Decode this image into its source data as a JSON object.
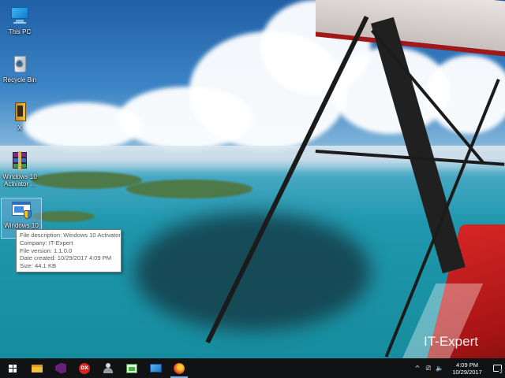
{
  "desktop": {
    "icons": [
      {
        "label": "This PC",
        "icon": "computer-icon"
      },
      {
        "label": "Recycle Bin",
        "icon": "recycle-bin-icon"
      },
      {
        "label": "X",
        "icon": "book-icon"
      },
      {
        "label": "Windows 10 Activator ...",
        "icon": "winrar-archive-icon"
      },
      {
        "label": "Windows 10 Ac",
        "icon": "activator-app-icon"
      }
    ],
    "watermark": "IT-Expert"
  },
  "tooltip": {
    "lines": [
      "File description: Windows 10 Activator",
      "Company: IT-Expert",
      "File version: 1.1.0.0",
      "Date created: 10/29/2017 4:09 PM",
      "Size: 44.1 KB"
    ]
  },
  "taskbar": {
    "pinned": [
      {
        "name": "start-button",
        "icon": "windows-logo-icon"
      },
      {
        "name": "file-explorer",
        "icon": "folder-icon"
      },
      {
        "name": "visual-studio",
        "icon": "visual-studio-icon"
      },
      {
        "name": "devexpress",
        "icon": "dx-icon",
        "text": "DX"
      },
      {
        "name": "user-app",
        "icon": "user-icon"
      },
      {
        "name": "activator-app",
        "icon": "activator-icon"
      },
      {
        "name": "remote-desktop",
        "icon": "remote-desktop-icon"
      },
      {
        "name": "firefox",
        "icon": "firefox-icon"
      }
    ],
    "tray": {
      "chevron": "^",
      "time": "4:09 PM",
      "date": "10/29/2017",
      "notification_count": "2"
    }
  },
  "colors": {
    "taskbar_bg": "#101214",
    "tooltip_border": "#767676",
    "selection": "#78aadc",
    "plane_red": "#d62626"
  }
}
